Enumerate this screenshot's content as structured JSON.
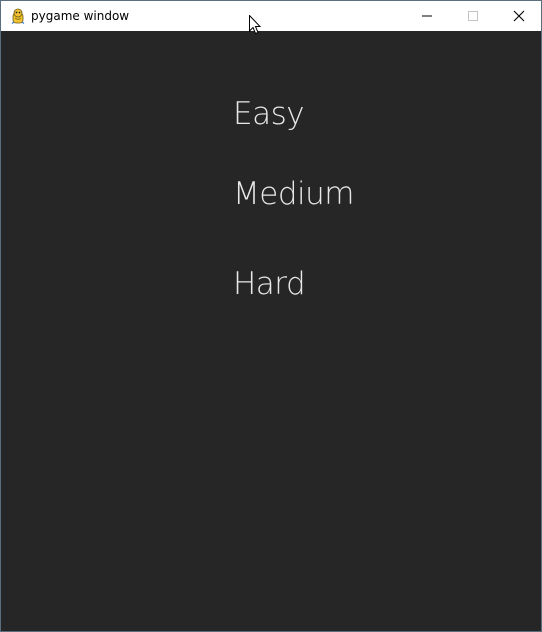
{
  "window": {
    "title": "pygame window",
    "icon": "pygame-snake-icon",
    "controls": {
      "minimize_icon": "minimize-icon",
      "maximize_icon": "maximize-icon",
      "close_icon": "close-icon"
    },
    "colors": {
      "titlebar_bg": "#ffffff",
      "client_bg": "#262626",
      "menu_text": "#e8e8e8"
    }
  },
  "menu": {
    "items": [
      {
        "label": "Easy"
      },
      {
        "label": "Medium"
      },
      {
        "label": "Hard"
      }
    ]
  }
}
